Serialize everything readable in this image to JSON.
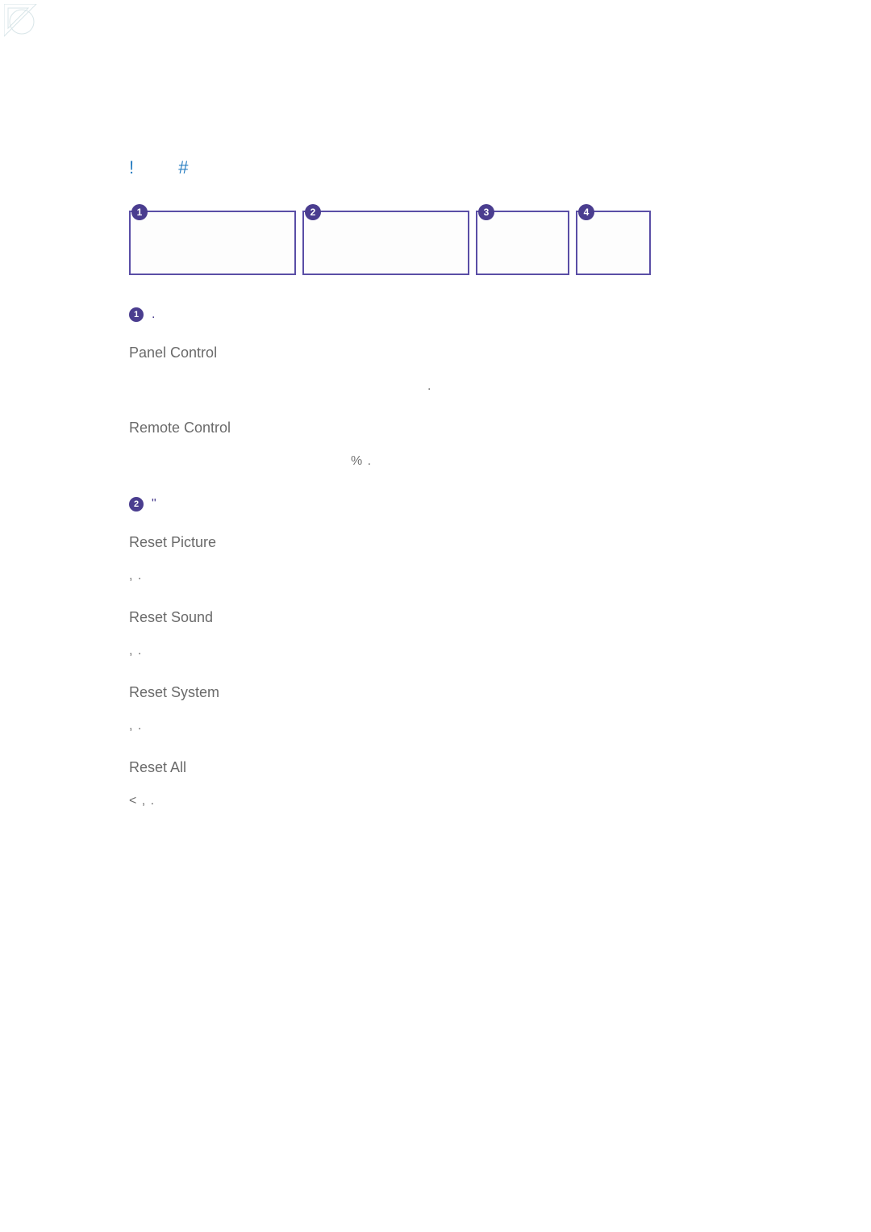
{
  "decoration": {
    "corner_present": true
  },
  "breadcrumb": {
    "item1": "!",
    "item2": "#"
  },
  "boxes": {
    "b1": "1",
    "b2": "2",
    "b3": "3",
    "b4": "4"
  },
  "section1": {
    "badge": "1",
    "mark": ".",
    "items": [
      {
        "title": "Panel Control",
        "desc": "."
      },
      {
        "title": "Remote Control",
        "desc": "%            ."
      }
    ]
  },
  "section2": {
    "badge": "2",
    "mark": "\"",
    "items": [
      {
        "title": "Reset Picture",
        "desc": ",                  ."
      },
      {
        "title": "Reset Sound",
        "desc": ",                  ."
      },
      {
        "title": "Reset System",
        "desc": ",                  ."
      },
      {
        "title": "Reset All",
        "desc": "<                                                ,              ."
      }
    ]
  }
}
